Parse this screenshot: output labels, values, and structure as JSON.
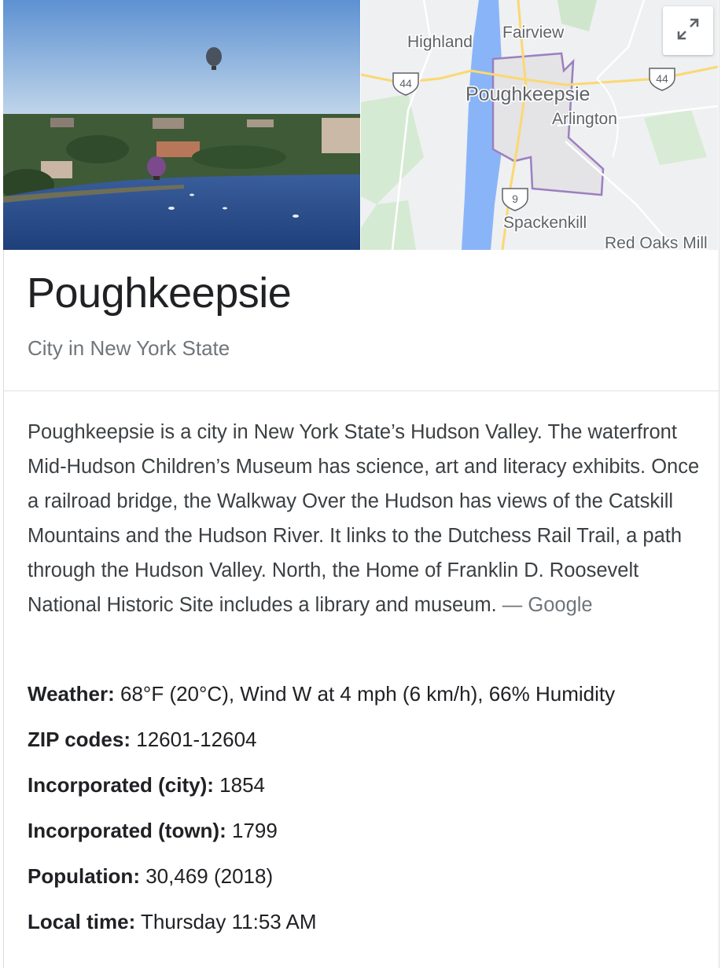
{
  "map": {
    "labels": {
      "highland": "Highland",
      "fairview": "Fairview",
      "poughkeepsie": "Poughkeepsie",
      "arlington": "Arlington",
      "spackenkill": "Spackenkill",
      "red_oaks_mill": "Red Oaks Mill"
    },
    "shields": {
      "route_44_west": "44",
      "route_44_east": "44",
      "route_9": "9"
    },
    "expand_icon": "expand-arrows-icon"
  },
  "entity": {
    "title": "Poughkeepsie",
    "subtitle": "City in New York State"
  },
  "description": {
    "text": "Poughkeepsie is a city in New York State’s Hudson Valley. The waterfront Mid-Hudson Children’s Museum has science, art and literacy exhibits. Once a railroad bridge, the Walkway Over the Hudson has views of the Catskill Mountains and the Hudson River. It links to the Dutchess Rail Trail, a path through the Hudson Valley. North, the Home of Franklin D. Roosevelt National Historic Site includes a library and museum.",
    "source": "— Google"
  },
  "facts": [
    {
      "key": "Weather:",
      "value": "68°F (20°C), Wind W at 4 mph (6 km/h), 66% Humidity"
    },
    {
      "key": "ZIP codes:",
      "value": "12601-12604"
    },
    {
      "key": "Incorporated (city):",
      "value": "1854"
    },
    {
      "key": "Incorporated (town):",
      "value": "1799"
    },
    {
      "key": "Population:",
      "value": "30,469 (2018)"
    },
    {
      "key": "Local time:",
      "value": "Thursday 11:53 AM"
    }
  ],
  "colors": {
    "river": "#2b4f8e",
    "map_water": "#8ab4f8",
    "boundary": "#9c7fc0",
    "road": "#fbd872"
  }
}
